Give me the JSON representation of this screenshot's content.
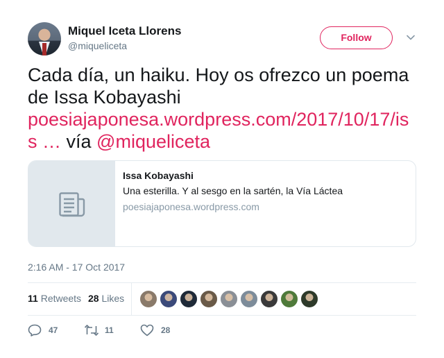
{
  "author": {
    "name": "Miquel Iceta Llorens",
    "handle": "@miqueliceta",
    "follow_label": "Follow"
  },
  "tweet": {
    "text_before": "Cada día, un haiku. Hoy os ofrezco un poema de Issa Kobayashi ",
    "url_text": "poesiajaponesa.wordpress.com/2017/10/17/iss …",
    "text_via": " vía ",
    "mention": "@miqueliceta"
  },
  "card": {
    "title": "Issa Kobayashi",
    "description": "Una esterilla. Y al sesgo en la sartén, la Vía Láctea",
    "domain": "poesiajaponesa.wordpress.com",
    "icon": "document-icon"
  },
  "timestamp": "2:16 AM - 17 Oct 2017",
  "stats": {
    "retweets_count": "11",
    "retweets_label": "Retweets",
    "likes_count": "28",
    "likes_label": "Likes"
  },
  "liked_by_avatars": [
    "#8a7a6a",
    "#3b4a7a",
    "#1f2a38",
    "#6a5a48",
    "#8a8f96",
    "#7d8c9a",
    "#3a3a3a",
    "#4f7a3a",
    "#2e3a2a"
  ],
  "actions": {
    "reply_count": "47",
    "retweet_count": "11",
    "like_count": "28"
  },
  "colors": {
    "accent": "#e0245e",
    "muted": "#657786",
    "text": "#14171a",
    "border": "#e1e8ed"
  }
}
